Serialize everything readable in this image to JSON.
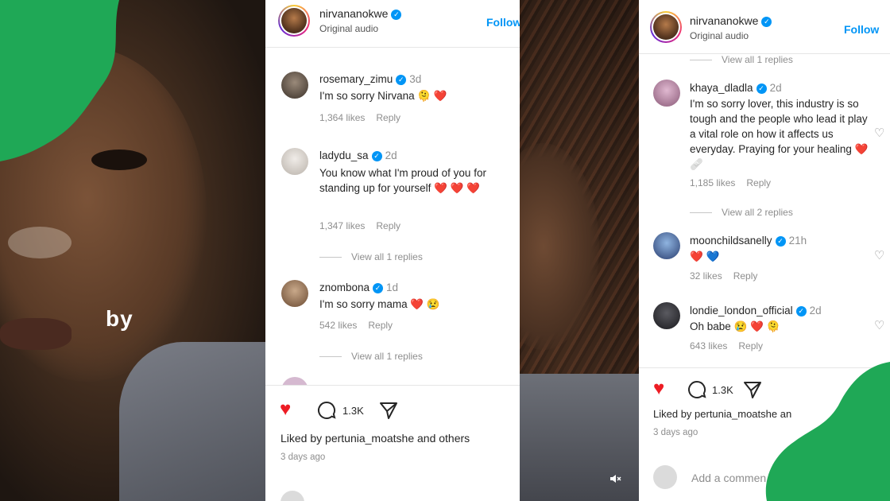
{
  "video_left": {
    "caption": "by"
  },
  "left_panel": {
    "username": "nirvananokwe",
    "subtitle": "Original audio",
    "follow_label": "Follow",
    "comments": [
      {
        "user": "rosemary_zimu",
        "time": "3d",
        "text": "I'm so sorry Nirvana 🫠 ❤️",
        "likes": "1,364 likes",
        "reply": "Reply"
      },
      {
        "user": "ladydu_sa",
        "time": "2d",
        "text": "You know what I'm proud of you for standing up for yourself ❤️ ❤️ ❤️",
        "likes": "1,347 likes",
        "reply": "Reply",
        "view_replies": "View all 1 replies"
      },
      {
        "user": "znombona",
        "time": "1d",
        "text": "I'm so sorry mama ❤️ 😢",
        "likes": "542 likes",
        "reply": "Reply",
        "view_replies": "View all 1 replies"
      }
    ],
    "comment_count": "1.3K",
    "liked_by": "Liked by pertunia_moatshe and others",
    "time_ago": "3 days ago"
  },
  "right_panel": {
    "username": "nirvananokwe",
    "subtitle": "Original audio",
    "follow_label": "Follow",
    "top_view_replies": "View all 1 replies",
    "comments": [
      {
        "user": "khaya_dladla",
        "time": "2d",
        "text": "I'm so sorry lover, this industry is so tough and the people who lead it play a vital role on how it affects us everyday. Praying for your healing ❤️ 🩹",
        "likes": "1,185 likes",
        "reply": "Reply",
        "view_replies": "View all 2 replies"
      },
      {
        "user": "moonchildsanelly",
        "time": "21h",
        "text": "❤️ 💙",
        "likes": "32 likes",
        "reply": "Reply"
      },
      {
        "user": "londie_london_official",
        "time": "2d",
        "text": "Oh babe 😢 ❤️ 🫠",
        "likes": "643 likes",
        "reply": "Reply"
      }
    ],
    "comment_count": "1.3K",
    "liked_by": "Liked by pertunia_moatshe an",
    "time_ago": "3 days ago",
    "add_comment_placeholder": "Add a commen"
  },
  "colors": {
    "accent_blue": "#0095f6",
    "like_red": "#ed1c24",
    "brand_green": "#1fa856"
  }
}
